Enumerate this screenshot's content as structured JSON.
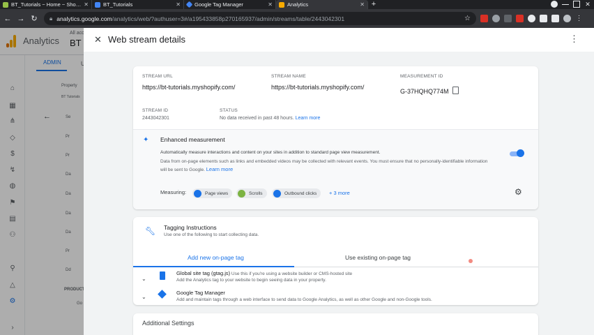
{
  "browser": {
    "tabs": [
      {
        "title": "BT_Tutorials ~ Home ~ Shopify",
        "favicon_color": "#95bf47",
        "active": false
      },
      {
        "title": "BT_Tutorials",
        "favicon_color": "#4285f4",
        "active": false
      },
      {
        "title": "Google Tag Manager",
        "favicon_color": "#4285f4",
        "active": false
      },
      {
        "title": "Analytics",
        "favicon_color": "#f9ab00",
        "active": true
      }
    ],
    "new_tab_label": "+",
    "url_host": "analytics.google.com",
    "url_path": "/analytics/web/?authuser=3#/a195433858p270165937/admin/streams/table/2443042301"
  },
  "app": {
    "title": "Analytics",
    "account_prefix": "All acc",
    "account_name": "BT T",
    "admin_tab": "ADMIN",
    "user_tab": "U",
    "property_label": "Property",
    "property_sub": "BT Tutorials",
    "products_label": "PRODUCT",
    "go_label": "Go",
    "nav_rows": [
      "Se",
      "Pr",
      "Pr",
      "Da",
      "Da",
      "Da",
      "Da",
      "Pr",
      "Dd"
    ]
  },
  "panel": {
    "title": "Web stream details",
    "stream_url_label": "STREAM URL",
    "stream_url": "https://bt-tutorials.myshopify.com/",
    "stream_name_label": "STREAM NAME",
    "stream_name": "https://bt-tutorials.myshopify.com/",
    "measurement_id_label": "MEASUREMENT ID",
    "measurement_id": "G-37HQHQ774M",
    "stream_id_label": "STREAM ID",
    "stream_id": "2443042301",
    "status_label": "STATUS",
    "status_text": "No data received in past 48 hours.",
    "status_link": "Learn more",
    "enhanced": {
      "title": "Enhanced measurement",
      "desc_bold": "Automatically measure interactions and content on your sites in addition to standard page view measurement.",
      "desc": "Data from on-page elements such as links and embedded videos may be collected with relevant events. You must ensure that no personally-identifiable information will be sent to Google.",
      "learn_more": "Learn more",
      "toggle_on": true,
      "measuring_label": "Measuring:",
      "chips": [
        {
          "label": "Page views",
          "color": "#1a73e8"
        },
        {
          "label": "Scrolls",
          "color": "#7cb342"
        },
        {
          "label": "Outbound clicks",
          "color": "#1a73e8"
        }
      ],
      "more_link": "+ 3 more"
    },
    "tagging": {
      "title": "Tagging Instructions",
      "subtitle": "Use one of the following to start collecting data.",
      "tab_add": "Add new on-page tag",
      "tab_existing": "Use existing on-page tag",
      "rows": [
        {
          "title": "Global site tag (gtag.js)",
          "title_suffix": " Use this if you're using a website builder or CMS-hosted site",
          "sub": "Add the Analytics tag to your website to begin seeing data in your property."
        },
        {
          "title": "Google Tag Manager",
          "title_suffix": "",
          "sub": "Add and maintain tags through a web interface to send data to Google Analytics, as well as other Google and non-Google tools."
        }
      ]
    },
    "additional_settings": "Additional Settings"
  },
  "colors": {
    "accent": "#1a73e8",
    "chrome_dark": "#202124"
  }
}
